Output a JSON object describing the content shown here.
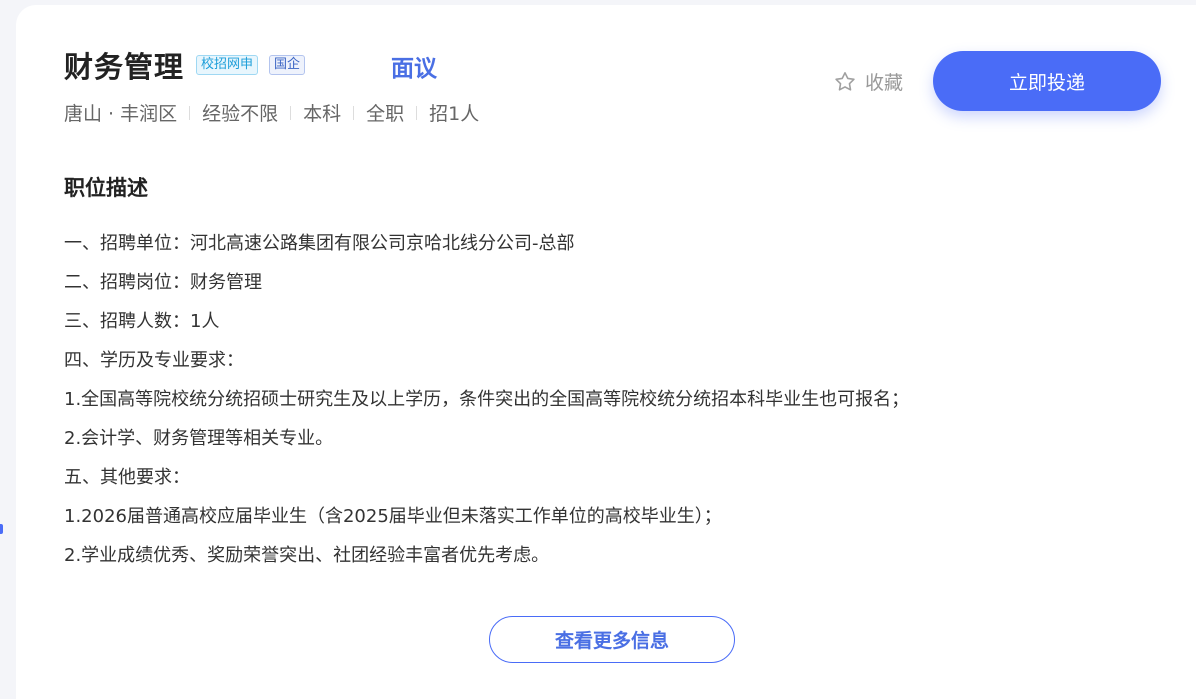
{
  "job": {
    "title": "财务管理",
    "tags": [
      "校招网申",
      "国企"
    ],
    "salary": "面议",
    "meta": [
      "唐山 · 丰润区",
      "经验不限",
      "本科",
      "全职",
      "招1人"
    ]
  },
  "actions": {
    "favorite_label": "收藏",
    "apply_label": "立即投递",
    "more_label": "查看更多信息"
  },
  "description": {
    "heading": "职位描述",
    "lines": [
      "一、招聘单位：河北高速公路集团有限公司京哈北线分公司-总部",
      "二、招聘岗位：财务管理",
      "三、招聘人数：1人",
      "四、学历及专业要求：",
      "1.全国高等院校统分统招硕士研究生及以上学历，条件突出的全国高等院校统分统招本科毕业生也可报名；",
      "2.会计学、财务管理等相关专业。",
      "五、其他要求：",
      "1.2026届普通高校应届毕业生（含2025届毕业但未落实工作单位的高校毕业生）；",
      "2.学业成绩优秀、奖励荣誉突出、社团经验丰富者优先考虑。"
    ]
  },
  "icons": {
    "favorite": "star-outline-icon"
  },
  "colors": {
    "accent": "#4a6cf7",
    "salary": "#4a6fe4",
    "tag_campus": "#1d9ed9",
    "tag_soe": "#3a64c4"
  }
}
